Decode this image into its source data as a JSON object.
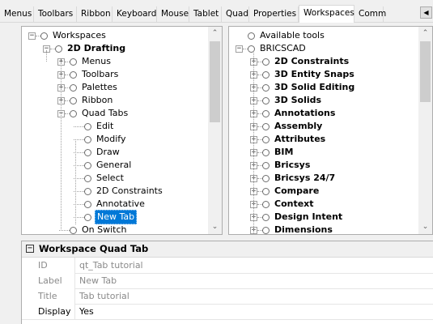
{
  "tabs": {
    "items": [
      "Menus",
      "Toolbars",
      "Ribbon",
      "Keyboard",
      "Mouse",
      "Tablet",
      "Quad",
      "Properties",
      "Workspaces",
      "Comm"
    ],
    "active": "Workspaces"
  },
  "left_tree": {
    "nodes": [
      {
        "label": "Workspaces",
        "bold": false,
        "expander": "minus"
      },
      {
        "label": "2D Drafting",
        "bold": true,
        "expander": "minus"
      },
      {
        "label": "Menus",
        "bold": false,
        "expander": "plus"
      },
      {
        "label": "Toolbars",
        "bold": false,
        "expander": "plus"
      },
      {
        "label": "Palettes",
        "bold": false,
        "expander": "plus"
      },
      {
        "label": "Ribbon",
        "bold": false,
        "expander": "plus"
      },
      {
        "label": "Quad Tabs",
        "bold": false,
        "expander": "minus"
      },
      {
        "label": "Edit",
        "bold": false,
        "expander": "none"
      },
      {
        "label": "Modify",
        "bold": false,
        "expander": "none"
      },
      {
        "label": "Draw",
        "bold": false,
        "expander": "none"
      },
      {
        "label": "General",
        "bold": false,
        "expander": "none"
      },
      {
        "label": "Select",
        "bold": false,
        "expander": "none"
      },
      {
        "label": "2D Constraints",
        "bold": false,
        "expander": "none"
      },
      {
        "label": "Annotative",
        "bold": false,
        "expander": "none"
      },
      {
        "label": "New Tab",
        "bold": false,
        "expander": "none",
        "selected": true
      },
      {
        "label": "On Switch",
        "bold": false,
        "expander": "none"
      }
    ]
  },
  "right_tree": {
    "nodes": [
      {
        "label": "Available tools",
        "bold": false,
        "expander": "none"
      },
      {
        "label": "BRICSCAD",
        "bold": false,
        "expander": "minus"
      },
      {
        "label": "2D Constraints",
        "bold": true,
        "expander": "plus"
      },
      {
        "label": "3D Entity Snaps",
        "bold": true,
        "expander": "plus"
      },
      {
        "label": "3D Solid Editing",
        "bold": true,
        "expander": "plus"
      },
      {
        "label": "3D Solids",
        "bold": true,
        "expander": "plus"
      },
      {
        "label": "Annotations",
        "bold": true,
        "expander": "plus"
      },
      {
        "label": "Assembly",
        "bold": true,
        "expander": "plus"
      },
      {
        "label": "Attributes",
        "bold": true,
        "expander": "plus"
      },
      {
        "label": "BIM",
        "bold": true,
        "expander": "plus"
      },
      {
        "label": "Bricsys",
        "bold": true,
        "expander": "plus"
      },
      {
        "label": "Bricsys 24/7",
        "bold": true,
        "expander": "plus"
      },
      {
        "label": "Compare",
        "bold": true,
        "expander": "plus"
      },
      {
        "label": "Context",
        "bold": true,
        "expander": "plus"
      },
      {
        "label": "Design Intent",
        "bold": true,
        "expander": "plus"
      },
      {
        "label": "Dimensions",
        "bold": true,
        "expander": "plus"
      }
    ]
  },
  "properties": {
    "title": "Workspace Quad Tab",
    "rows": [
      {
        "key": "ID",
        "value": "qt_Tab tutorial",
        "readonly": true
      },
      {
        "key": "Label",
        "value": "New Tab",
        "readonly": true
      },
      {
        "key": "Title",
        "value": "Tab tutorial",
        "readonly": true
      },
      {
        "key": "Display",
        "value": "Yes",
        "readonly": false
      }
    ]
  },
  "icons": {
    "expand": "plus-box-icon",
    "collapse": "minus-box-icon",
    "node": "radio-circle-icon",
    "scroll_up": "chevron-up-icon",
    "scroll_down": "chevron-down-icon",
    "tab_scroll_left": "tab-scroll-left-icon"
  },
  "colors": {
    "selection": "#0078d7",
    "panel_bg": "#ffffff",
    "window_bg": "#f0f0f0"
  }
}
